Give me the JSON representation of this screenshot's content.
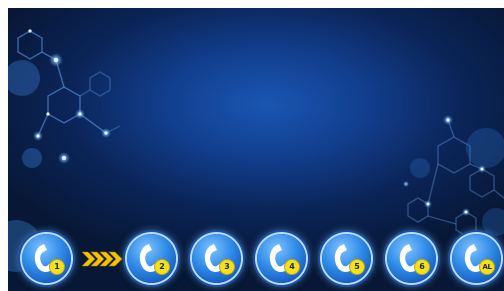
{
  "ui": {
    "accent_blue": "#2f8ae8",
    "badge_yellow": "#f2e11c",
    "arrow_color": "#f5c400"
  },
  "contacts": [
    {
      "badge": "1",
      "icon": "phone-handset-icon"
    },
    {
      "badge": "2",
      "icon": "phone-handset-icon"
    },
    {
      "badge": "3",
      "icon": "phone-handset-icon"
    },
    {
      "badge": "4",
      "icon": "phone-handset-icon"
    },
    {
      "badge": "5",
      "icon": "phone-handset-icon"
    },
    {
      "badge": "6",
      "icon": "phone-handset-icon"
    },
    {
      "badge": "AL",
      "icon": "phone-handset-icon"
    }
  ],
  "flow_indicator": {
    "icon": "chevron-arrows-icon"
  }
}
